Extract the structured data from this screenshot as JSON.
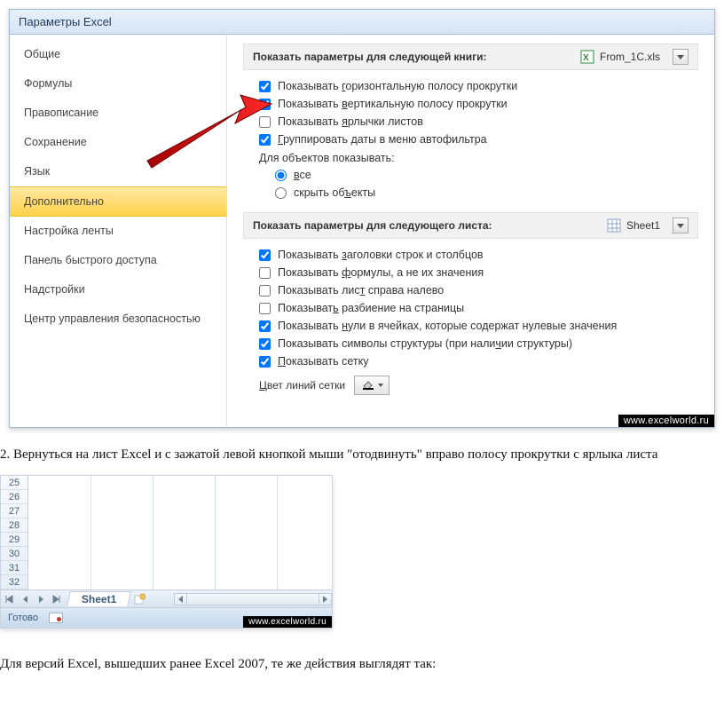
{
  "dialog": {
    "title": "Параметры Excel"
  },
  "sidebar": {
    "items": [
      {
        "label": "Общие"
      },
      {
        "label": "Формулы"
      },
      {
        "label": "Правописание"
      },
      {
        "label": "Сохранение"
      },
      {
        "label": "Язык"
      },
      {
        "label": "Дополнительно"
      },
      {
        "label": "Настройка ленты"
      },
      {
        "label": "Панель быстрого доступа"
      },
      {
        "label": "Надстройки"
      },
      {
        "label": "Центр управления безопасностью"
      }
    ],
    "selected_index": 5
  },
  "workbook_section": {
    "label": "Показать параметры для следующей книги:",
    "combo_value": "From_1C.xls",
    "checks": [
      {
        "checked": true,
        "pre": "Показывать ",
        "u": "г",
        "post": "оризонтальную полосу прокрутки"
      },
      {
        "checked": true,
        "pre": "Показывать ",
        "u": "в",
        "post": "ертикальную полосу прокрутки"
      },
      {
        "checked": false,
        "pre": "Показывать ",
        "u": "я",
        "post": "рлычки листов"
      },
      {
        "checked": true,
        "pre": "",
        "u": "Г",
        "post": "руппировать даты в меню автофильтра"
      }
    ],
    "objects_label": "Для объектов показывать:",
    "radios": [
      {
        "checked": true,
        "pre": "",
        "u": "в",
        "post": "се"
      },
      {
        "checked": false,
        "pre": "скрыть об",
        "u": "ъ",
        "post": "екты"
      }
    ]
  },
  "sheet_section": {
    "label": "Показать параметры для следующего листа:",
    "combo_value": "Sheet1",
    "checks": [
      {
        "checked": true,
        "pre": "Показывать ",
        "u": "з",
        "post": "аголовки строк и столбцов"
      },
      {
        "checked": false,
        "pre": "Показывать ",
        "u": "ф",
        "post": "ормулы, а не их значения"
      },
      {
        "checked": false,
        "pre": "Показывать лис",
        "u": "т",
        "post": " справа налево"
      },
      {
        "checked": false,
        "pre": "Показыват",
        "u": "ь",
        "post": " разбиение на страницы"
      },
      {
        "checked": true,
        "pre": "Показывать ",
        "u": "н",
        "post": "ули в ячейках, которые содержат нулевые значения"
      },
      {
        "checked": true,
        "pre": "Показывать символы структуры (при нали",
        "u": "ч",
        "post": "ии структуры)"
      },
      {
        "checked": true,
        "pre": "",
        "u": "П",
        "post": "оказывать сетку"
      }
    ],
    "gridline_color": {
      "pre": "",
      "u": "Ц",
      "post": "вет линий сетки"
    }
  },
  "watermark": "www.excelworld.ru",
  "article": {
    "step2": "2. Вернуться на лист Excel и с зажатой левой кнопкой мыши \"отодвинуть\" вправо полосу прокрутки с ярлыка листа",
    "footer": "Для версий Excel, вышедших ранее Excel 2007, те же действия выглядят так:"
  },
  "shot2": {
    "rows": [
      "25",
      "26",
      "27",
      "28",
      "29",
      "30",
      "31",
      "32"
    ],
    "sheet_tab": "Sheet1",
    "status": "Готово"
  }
}
